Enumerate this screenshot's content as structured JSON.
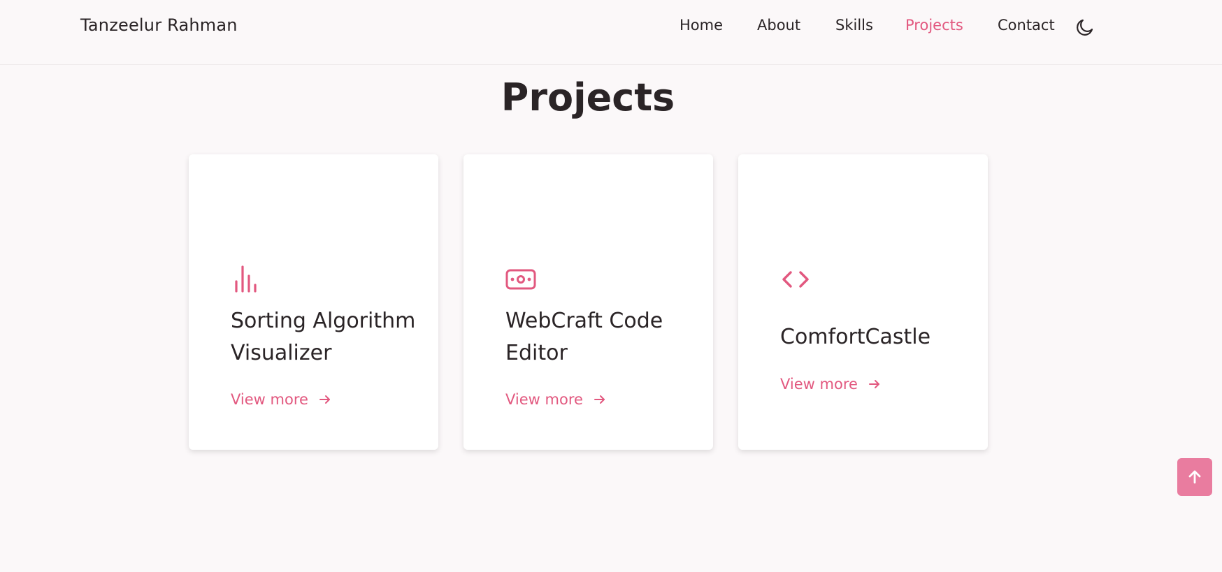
{
  "header": {
    "logo": "Tanzeelur Rahman",
    "nav": [
      {
        "label": "Home",
        "active": false
      },
      {
        "label": "About",
        "active": false
      },
      {
        "label": "Skills",
        "active": false
      },
      {
        "label": "Projects",
        "active": true
      },
      {
        "label": "Contact",
        "active": false
      }
    ],
    "theme_icon": "moon-icon"
  },
  "main": {
    "title": "Projects",
    "projects": [
      {
        "title": "Sorting Algorithm Visualizer",
        "link": "View more",
        "icon": "bar-chart-icon"
      },
      {
        "title": "WebCraft Code Editor",
        "link": "View more",
        "icon": "money-bill-icon"
      },
      {
        "title": "ComfortCastle",
        "link": "View more",
        "icon": "code-icon"
      }
    ]
  },
  "scroll_top_icon": "arrow-up-icon",
  "colors": {
    "accent": "#e2587f",
    "scroll_button": "#e97c9f",
    "background": "#fbf8f9",
    "text": "#2a2426"
  }
}
